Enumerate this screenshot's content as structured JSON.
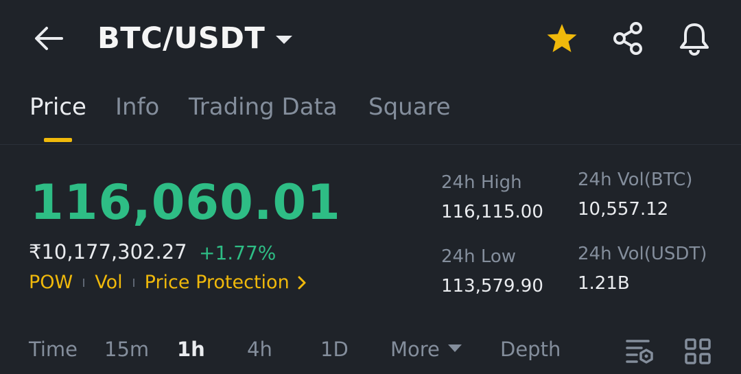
{
  "header": {
    "pair": "BTC/USDT",
    "icons": [
      "back-arrow-icon",
      "caret-down-icon",
      "star-icon",
      "share-icon",
      "bell-icon"
    ],
    "favorite_color": "#f0b90b"
  },
  "tabs": [
    {
      "label": "Price",
      "active": true
    },
    {
      "label": "Info",
      "active": false
    },
    {
      "label": "Trading Data",
      "active": false
    },
    {
      "label": "Square",
      "active": false
    }
  ],
  "price": {
    "last": "116,060.01",
    "fiat": "₹10,177,302.27",
    "change": "+1.77%",
    "up_color": "#2ebd85"
  },
  "tags": [
    "POW",
    "Vol",
    "Price Protection"
  ],
  "stats": {
    "high_label": "24h High",
    "high_value": "116,115.00",
    "low_label": "24h Low",
    "low_value": "113,579.90",
    "vol_btc_label": "24h Vol(BTC)",
    "vol_btc_value": "10,557.12",
    "vol_usdt_label": "24h Vol(USDT)",
    "vol_usdt_value": "1.21B"
  },
  "timeframes": {
    "time": "Time",
    "m15": "15m",
    "h1": "1h",
    "h4": "4h",
    "d1": "1D",
    "more": "More",
    "depth": "Depth",
    "selected": "1h"
  },
  "toolbar_icons": [
    "indicator-settings-icon",
    "grid-layout-icon"
  ]
}
